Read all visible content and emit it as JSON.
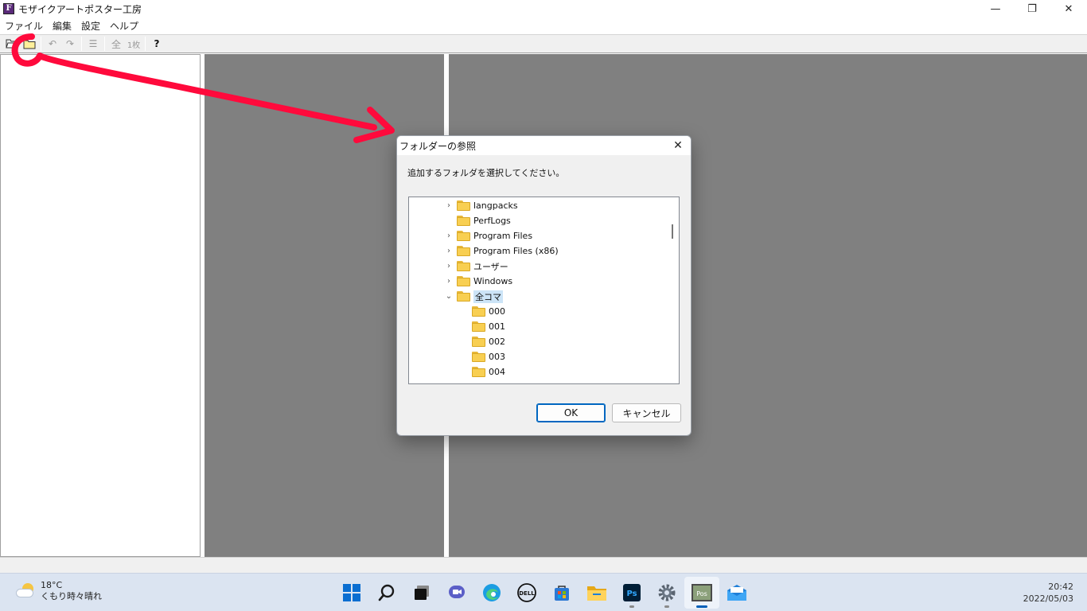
{
  "window": {
    "app_icon_letter": "F",
    "title": "モザイクアートポスター工房",
    "minimize_glyph": "—",
    "restore_glyph": "❐",
    "close_glyph": "✕"
  },
  "menu": {
    "items": [
      {
        "label": "ファイル"
      },
      {
        "label": "編集"
      },
      {
        "label": "設定"
      },
      {
        "label": "ヘルプ"
      }
    ]
  },
  "toolbar": {
    "buttons": [
      {
        "glyph": "⊏",
        "icon": "open-file-icon"
      },
      {
        "glyph": "▭",
        "icon": "open-folder-icon"
      },
      {
        "glyph": "↶",
        "icon": "undo-icon"
      },
      {
        "glyph": "↷",
        "icon": "redo-icon"
      },
      {
        "glyph": "☰",
        "icon": "list-icon"
      },
      {
        "glyph": "全",
        "icon": "all-frames-icon"
      },
      {
        "glyph": "1枚",
        "icon": "single-frame-icon"
      },
      {
        "glyph": "?",
        "icon": "help-icon"
      }
    ]
  },
  "dialog": {
    "title": "フォルダーの参照",
    "close_glyph": "✕",
    "description": "追加するフォルダを選択してください。",
    "tree": [
      {
        "label": "langpacks",
        "expander": "›",
        "level": 0
      },
      {
        "label": "PerfLogs",
        "expander": "",
        "level": 0
      },
      {
        "label": "Program Files",
        "expander": "›",
        "level": 0
      },
      {
        "label": "Program Files (x86)",
        "expander": "›",
        "level": 0
      },
      {
        "label": "ユーザー",
        "expander": "›",
        "level": 0
      },
      {
        "label": "Windows",
        "expander": "›",
        "level": 0
      },
      {
        "label": "全コマ",
        "expander": "⌄",
        "level": 0,
        "selected": true
      },
      {
        "label": "000",
        "expander": "",
        "level": 1
      },
      {
        "label": "001",
        "expander": "",
        "level": 1
      },
      {
        "label": "002",
        "expander": "",
        "level": 1
      },
      {
        "label": "003",
        "expander": "",
        "level": 1
      },
      {
        "label": "004",
        "expander": "",
        "level": 1
      }
    ],
    "ok_label": "OK",
    "cancel_label": "キャンセル"
  },
  "taskbar": {
    "weather_temp": "18°C",
    "weather_desc": "くもり時々晴れ",
    "time": "20:42",
    "date": "2022/05/03",
    "apps": [
      {
        "icon": "windows-start-icon",
        "active": false,
        "running": false
      },
      {
        "icon": "search-icon",
        "active": false,
        "running": false
      },
      {
        "icon": "task-view-icon",
        "active": false,
        "running": false
      },
      {
        "icon": "chat-icon",
        "active": false,
        "running": false
      },
      {
        "icon": "edge-icon",
        "active": false,
        "running": false
      },
      {
        "icon": "dell-icon",
        "active": false,
        "running": false
      },
      {
        "icon": "store-icon",
        "active": false,
        "running": false
      },
      {
        "icon": "file-explorer-icon",
        "active": false,
        "running": false
      },
      {
        "icon": "photoshop-icon",
        "active": false,
        "running": true
      },
      {
        "icon": "settings-icon",
        "active": false,
        "running": true
      },
      {
        "icon": "mosaic-app-icon",
        "active": true,
        "running": true
      },
      {
        "icon": "mail-icon",
        "active": false,
        "running": false
      }
    ],
    "photoshop_label": "Ps",
    "mosaic_label": "Pos",
    "dell_label": "DELL"
  },
  "colors": {
    "pane_gray": "#808080",
    "annotation_red": "#ff0a3c",
    "selection": "#cce4f7",
    "accent": "#005fb8"
  }
}
